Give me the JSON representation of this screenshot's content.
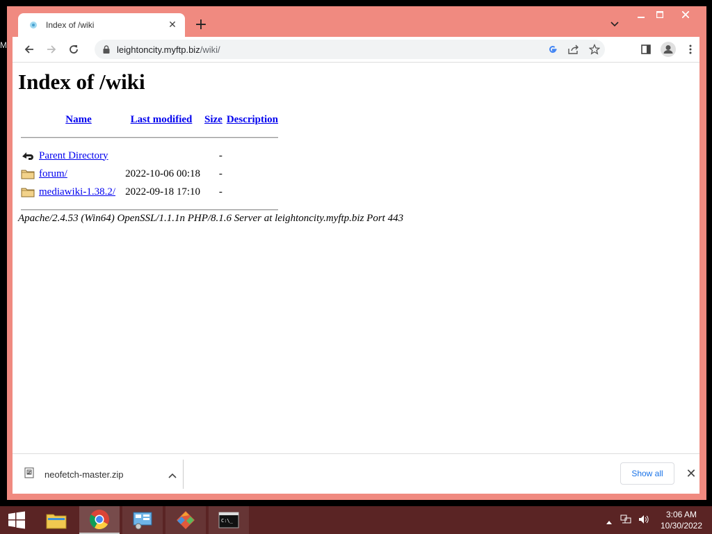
{
  "desktop": {
    "edge_text": "M"
  },
  "browser": {
    "tab": {
      "title": "Index of /wiki"
    },
    "omnibox": {
      "host": "leightoncity.myftp.biz",
      "path": "/wiki/"
    }
  },
  "page": {
    "heading": "Index of /wiki",
    "columns": {
      "name": "Name",
      "last_modified": "Last modified",
      "size": "Size",
      "description": "Description"
    },
    "entries": [
      {
        "icon": "back-icon",
        "name": "Parent Directory",
        "modified": "",
        "size": "-"
      },
      {
        "icon": "folder-icon",
        "name": "forum/",
        "modified": "2022-10-06 00:18",
        "size": "-"
      },
      {
        "icon": "folder-icon",
        "name": "mediawiki-1.38.2/",
        "modified": "2022-09-18 17:10",
        "size": "-"
      }
    ],
    "address": "Apache/2.4.53 (Win64) OpenSSL/1.1.1n PHP/8.1.6 Server at leightoncity.myftp.biz Port 443"
  },
  "downloads": {
    "file": "neofetch-master.zip",
    "show_all": "Show all"
  },
  "taskbar": {
    "time": "3:06 AM",
    "date": "10/30/2022",
    "colors": {
      "bar": "#5a2424",
      "window_frame": "#f08a80"
    }
  }
}
